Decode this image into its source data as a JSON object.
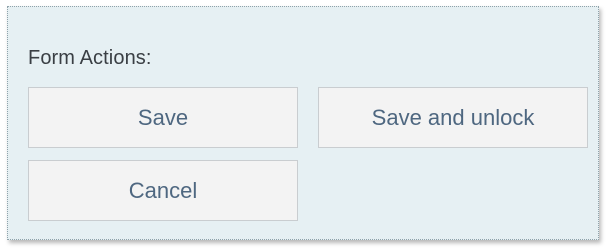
{
  "form_actions": {
    "title": "Form Actions:",
    "buttons": {
      "save": "Save",
      "save_and_unlock": "Save and unlock",
      "cancel": "Cancel"
    }
  },
  "colors": {
    "panel_background": "#e6f0f3",
    "button_background": "#f3f3f3",
    "button_text": "#4e6780",
    "title_text": "#3a3f44"
  }
}
